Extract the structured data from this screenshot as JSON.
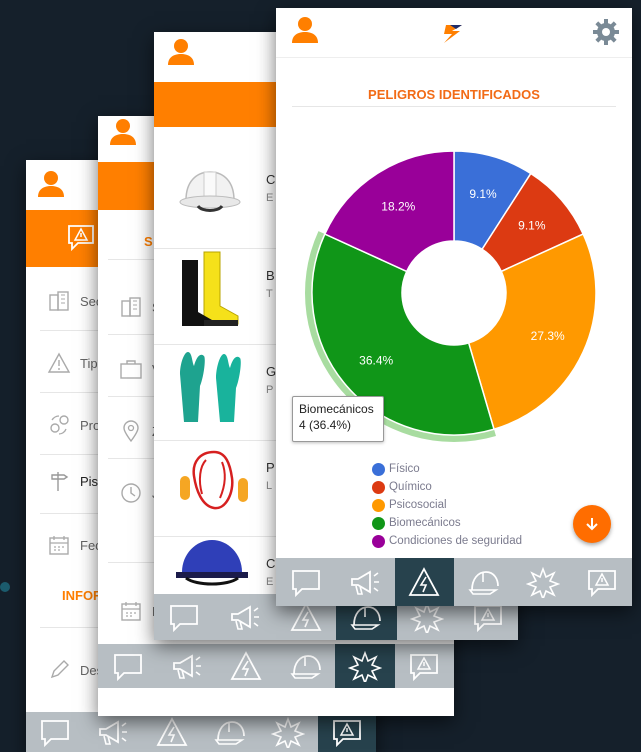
{
  "colors": {
    "orange": "#ff7f00",
    "nav": "#b7bec3",
    "nav_active": "#27424d"
  },
  "screen1": {
    "menu": [
      {
        "label": "Sec",
        "icon": "buildings-icon"
      },
      {
        "label": "Tipo",
        "icon": "warning-icon"
      },
      {
        "label": "Pro",
        "icon": "process-icon"
      },
      {
        "label": "Piso",
        "icon": "signpost-icon"
      },
      {
        "label": "Fec",
        "icon": "calendar-icon"
      }
    ],
    "section_label": "INFOR",
    "desc_label": "Des",
    "nav_active": 5
  },
  "screen2": {
    "header_label": "S",
    "menu": [
      {
        "label": "S",
        "icon": "buildings-icon"
      },
      {
        "label": "V",
        "icon": "briefcase-icon"
      },
      {
        "label": "Z",
        "icon": "location-icon"
      },
      {
        "label": "J",
        "icon": "clock-icon"
      },
      {
        "label": "F",
        "icon": "calendar-icon"
      }
    ],
    "nav_active": 4
  },
  "screen3": {
    "products": [
      {
        "name": "C",
        "sub": "E",
        "icon": "hard-hat-icon"
      },
      {
        "name": "B",
        "sub": "T",
        "icon": "boots-icon"
      },
      {
        "name": "G",
        "sub": "P",
        "icon": "gloves-icon"
      },
      {
        "name": "P",
        "sub": "L",
        "icon": "earplugs-icon"
      },
      {
        "name": "C",
        "sub": "E",
        "icon": "bump-cap-icon"
      }
    ],
    "nav_active": 3
  },
  "screen4": {
    "title": "PELIGROS IDENTIFICADOS",
    "tooltip": {
      "line1": "Biomecánicos",
      "line2": "4 (36.4%)"
    },
    "nav_active": 2
  },
  "chart_data": {
    "type": "pie",
    "labels": [
      "Físico",
      "Químico",
      "Psicosocial",
      "Biomecánicos",
      "Condiciones de seguridad"
    ],
    "values": [
      1,
      1,
      3,
      4,
      2
    ],
    "percent_labels": [
      "9.1%",
      "9.1%",
      "27.3%",
      "36.4%",
      "18.2%"
    ],
    "colors": [
      "#3a6fd8",
      "#dc3a12",
      "#ff9900",
      "#109618",
      "#990099"
    ],
    "legend_position": "bottom"
  }
}
